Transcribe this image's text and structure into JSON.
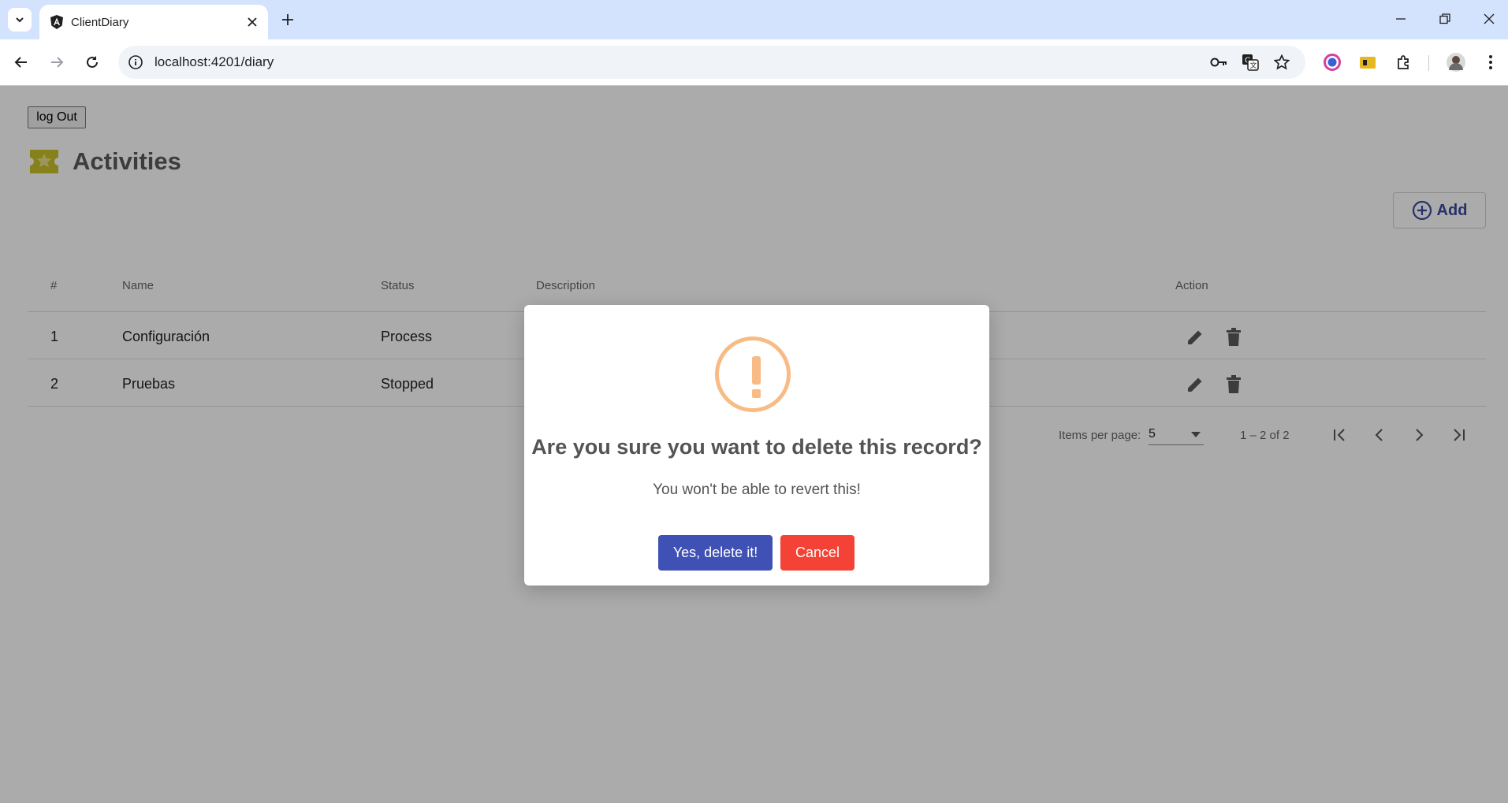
{
  "browser": {
    "tab_title": "ClientDiary",
    "url": "localhost:4201/diary"
  },
  "page": {
    "logout_label": "log Out",
    "title": "Activities",
    "add_label": "Add",
    "table": {
      "headers": [
        "#",
        "Name",
        "Status",
        "Description",
        "Action"
      ],
      "rows": [
        {
          "num": "1",
          "name": "Configuración",
          "status": "Process"
        },
        {
          "num": "2",
          "name": "Pruebas",
          "status": "Stopped"
        }
      ]
    },
    "paginator": {
      "items_per_page_label": "Items per page:",
      "page_size": "5",
      "range": "1 – 2 of 2"
    }
  },
  "dialog": {
    "title": "Are you sure you want to delete this record?",
    "text": "You won't be able to revert this!",
    "confirm_label": "Yes, delete it!",
    "cancel_label": "Cancel"
  },
  "colors": {
    "confirm": "#3f51b5",
    "cancel": "#f44336",
    "warning": "#f8bb86",
    "title_icon": "#c9c12b"
  }
}
